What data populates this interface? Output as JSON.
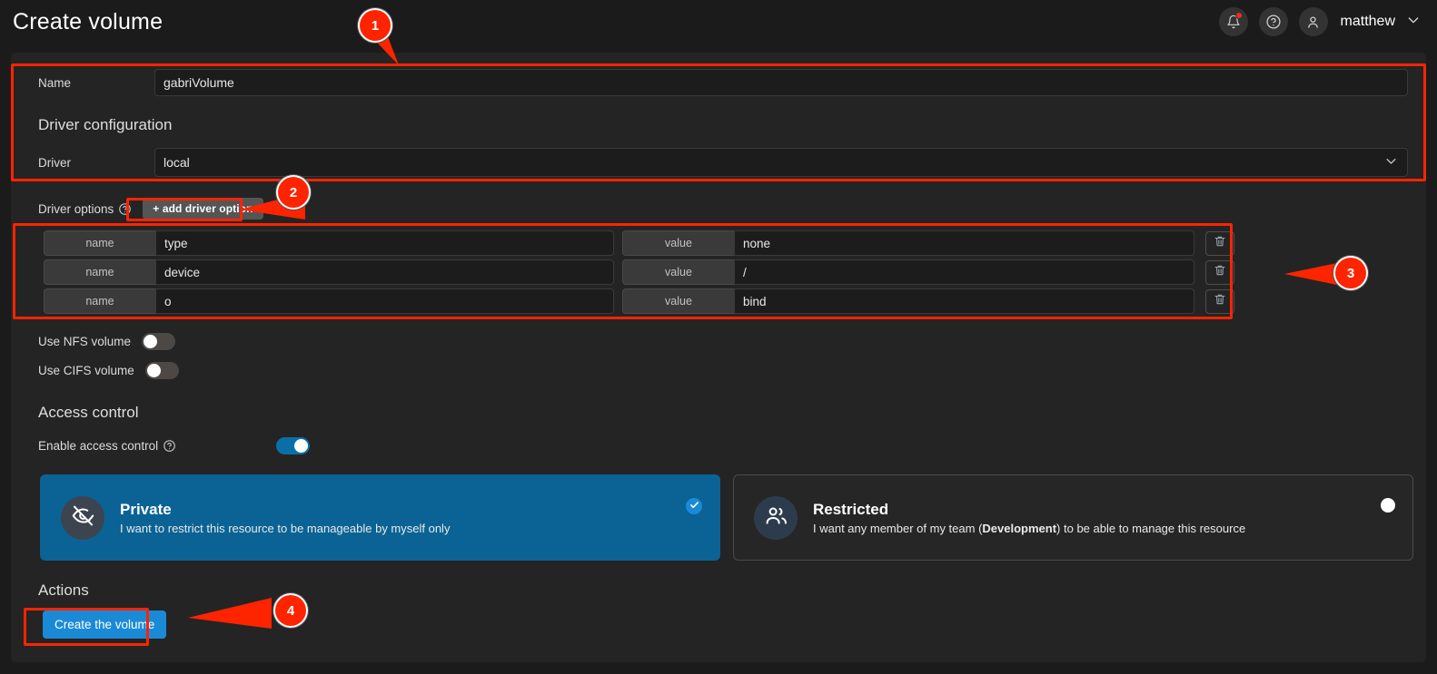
{
  "header": {
    "title": "Create volume",
    "username": "matthew",
    "icons": {
      "bell": "bell-icon",
      "help": "help-icon",
      "avatar": "user-avatar-icon",
      "chevron": "chevron-down-icon"
    }
  },
  "form": {
    "name_label": "Name",
    "name_value": "gabriVolume",
    "driver_config_title": "Driver configuration",
    "driver_label": "Driver",
    "driver_value": "local",
    "driver_options_label": "Driver options",
    "add_driver_option_label": "+ add driver option",
    "option_name_placeholder": "name",
    "option_value_placeholder": "value",
    "driver_options": [
      {
        "name": "type",
        "value": "none"
      },
      {
        "name": "device",
        "value": "/"
      },
      {
        "name": "o",
        "value": "bind"
      }
    ],
    "use_nfs_label": "Use NFS volume",
    "use_nfs_on": false,
    "use_cifs_label": "Use CIFS volume",
    "use_cifs_on": false
  },
  "access_control": {
    "section_title": "Access control",
    "enable_label": "Enable access control",
    "enabled": true,
    "cards": [
      {
        "title": "Private",
        "desc_prefix": "I want to restrict this resource to be manageable by myself only",
        "desc_bold": "",
        "desc_suffix": "",
        "selected": true,
        "icon": "eye-off-icon"
      },
      {
        "title": "Restricted",
        "desc_prefix": "I want any member of my team (",
        "desc_bold": "Development",
        "desc_suffix": ") to be able to manage this resource",
        "selected": false,
        "icon": "users-icon"
      }
    ]
  },
  "actions": {
    "section_title": "Actions",
    "create_label": "Create the volume"
  },
  "annotations": {
    "markers": [
      "1",
      "2",
      "3",
      "4"
    ],
    "accent_color": "#ff2400"
  },
  "colors": {
    "page_bg": "#1b1b1b",
    "panel_bg": "#242424",
    "accent_blue": "#1b8ad6",
    "card_selected_bg": "#0a6394",
    "annotation_red": "#ff2400"
  }
}
